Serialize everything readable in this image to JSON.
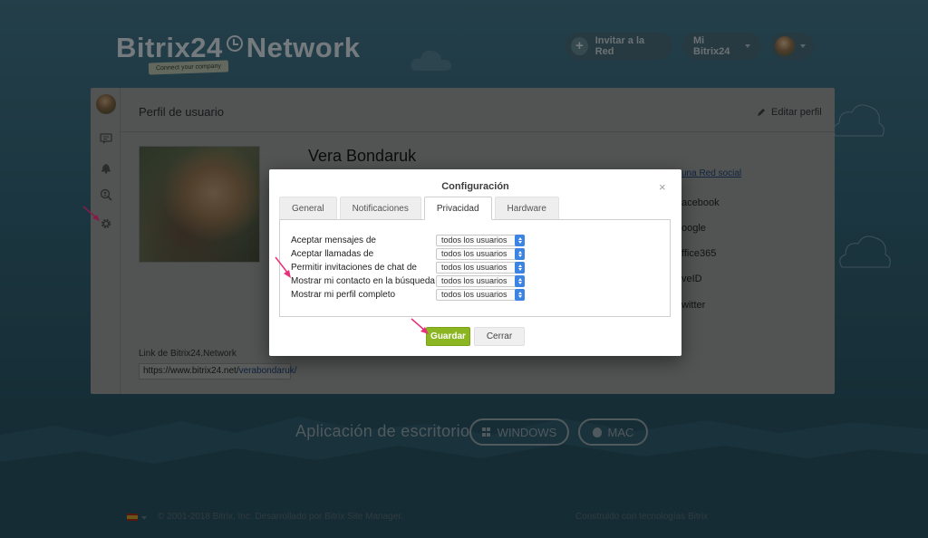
{
  "header": {
    "logo_main": "Bitrix24",
    "logo_network": "Network",
    "logo_tag": "Connect your company",
    "invite_label": "Invitar a la Red",
    "my_bitrix_label": "Mi Bitrix24"
  },
  "profile": {
    "title": "Perfil de usuario",
    "edit_label": "Editar perfil",
    "name": "Vera Bondaruk",
    "social_link": "una Red social",
    "socials": [
      "acebook",
      "oogle",
      "ffice365",
      "veID",
      "witter"
    ],
    "network_link_label": "Link de Bitrix24.Network",
    "network_link_base": "https://www.bitrix24.net/",
    "network_link_user": "verabondaruk/"
  },
  "dialog": {
    "title": "Configuración",
    "close_glyph": "×",
    "tabs": [
      {
        "label": "General",
        "active": false
      },
      {
        "label": "Notificaciones",
        "active": false
      },
      {
        "label": "Privacidad",
        "active": true
      },
      {
        "label": "Hardware",
        "active": false
      }
    ],
    "settings": [
      {
        "label": "Aceptar mensajes de",
        "value": "todos los usuarios"
      },
      {
        "label": "Aceptar llamadas de",
        "value": "todos los usuarios"
      },
      {
        "label": "Permitir invitaciones de chat de",
        "value": "todos los usuarios"
      },
      {
        "label": "Mostrar mi contacto en la búsqueda",
        "value": "todos los usuarios"
      },
      {
        "label": "Mostrar mi perfil completo",
        "value": "todos los usuarios"
      }
    ],
    "save_label": "Guardar",
    "cancel_label": "Cerrar"
  },
  "desktop": {
    "label": "Aplicación de escritorio",
    "windows_label": "WINDOWS",
    "mac_label": "MAC"
  },
  "footer": {
    "copyright": "© 2001-2018 Bitrix, Inc. Desarrollado por Bitrix Site Manager.",
    "built_with": "Construido con tecnologías Bitrix"
  },
  "colors": {
    "save_green": "#8bb621",
    "select_blue": "#3b84e3",
    "annotation_pink": "#e8307a"
  }
}
